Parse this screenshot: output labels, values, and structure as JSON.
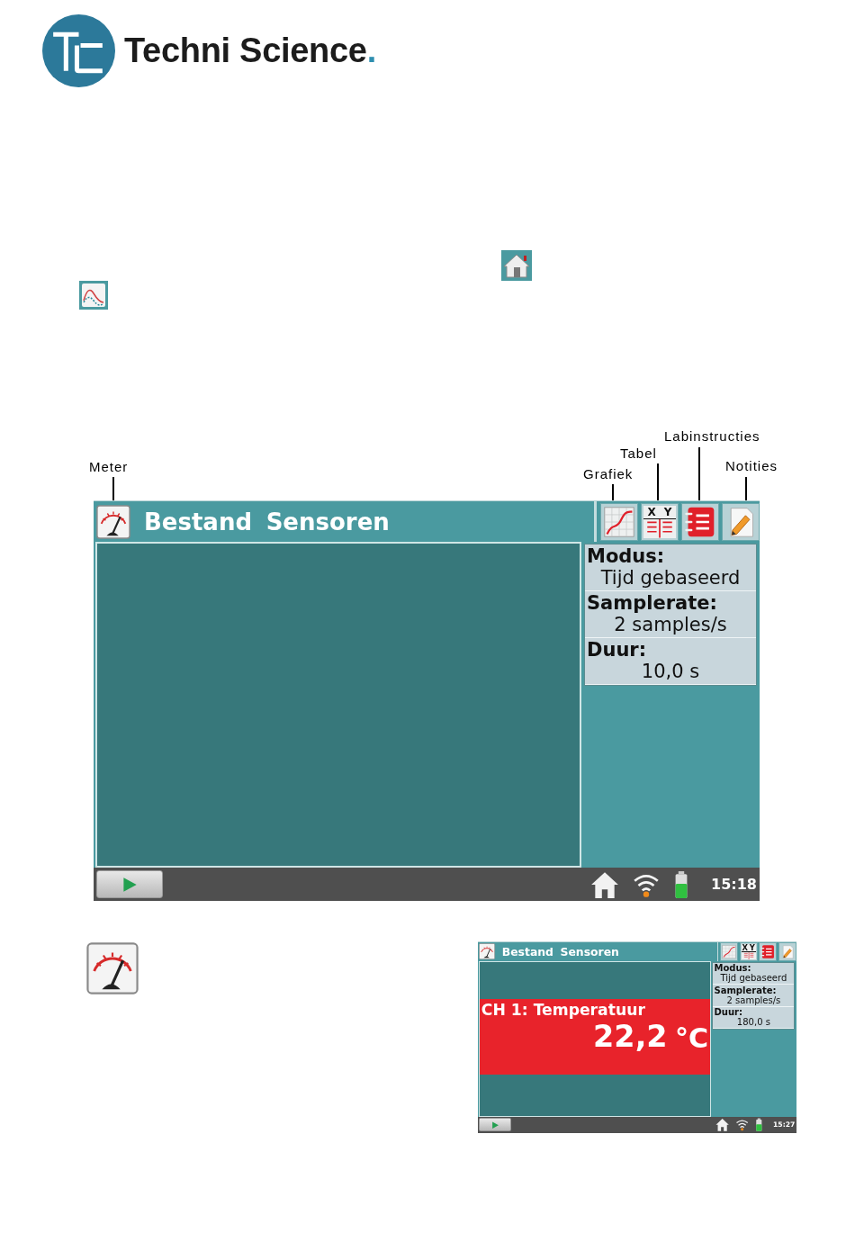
{
  "brand": {
    "name": "Techni Science",
    "mark": "."
  },
  "screens": [
    {
      "menus": [
        "Bestand",
        "Sensoren"
      ],
      "toolbar": [
        {
          "kind": "graph"
        },
        {
          "kind": "table",
          "labels": [
            "X",
            "Y"
          ]
        },
        {
          "kind": "instructions"
        },
        {
          "kind": "notes"
        }
      ],
      "callouts": [
        "Meter",
        "Grafiek",
        "Tabel",
        "Labinstructies",
        "Notities"
      ],
      "settings": [
        {
          "label": "Modus:",
          "value": "Tijd gebaseerd"
        },
        {
          "label": "Samplerate:",
          "value": "2 samples/s"
        },
        {
          "label": "Duur:",
          "value": "10,0 s"
        }
      ],
      "clock": "15:18"
    },
    {
      "menus": [
        "Bestand",
        "Sensoren"
      ],
      "toolbar": [
        {
          "kind": "graph"
        },
        {
          "kind": "table",
          "labels": [
            "X",
            "Y"
          ]
        },
        {
          "kind": "instructions"
        },
        {
          "kind": "notes"
        }
      ],
      "settings": [
        {
          "label": "Modus:",
          "value": "Tijd gebaseerd"
        },
        {
          "label": "Samplerate:",
          "value": "2 samples/s"
        },
        {
          "label": "Duur:",
          "value": "180,0 s"
        }
      ],
      "channel": {
        "name": "CH 1: Temperatuur",
        "value": "22,2",
        "unit": "°C",
        "color": "#e8232b"
      },
      "clock": "15:27"
    }
  ]
}
